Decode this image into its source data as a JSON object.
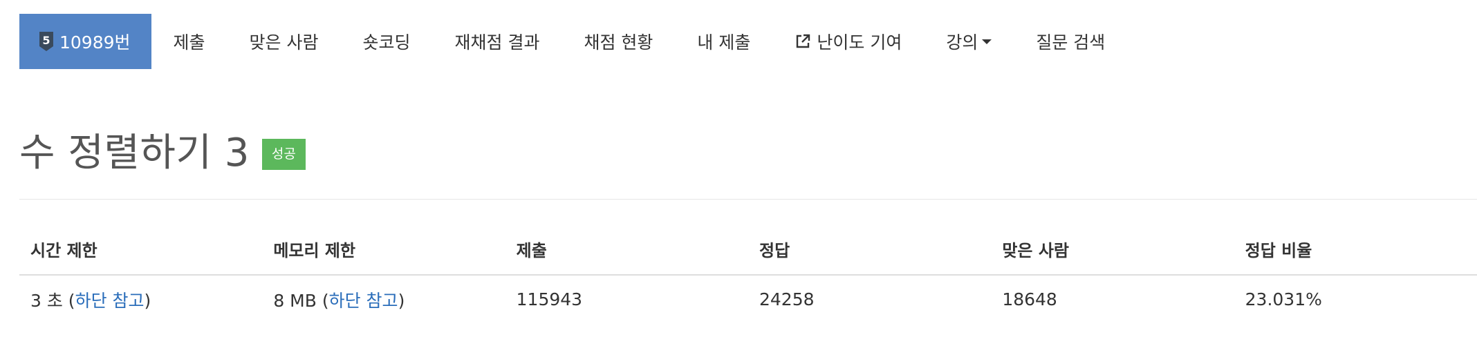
{
  "nav": {
    "problem_tier": "5",
    "problem_id": "10989번",
    "items": [
      "제출",
      "맞은 사람",
      "숏코딩",
      "재채점 결과",
      "채점 현황",
      "내 제출",
      "난이도 기여",
      "강의",
      "질문 검색"
    ],
    "active_color": "#5384c6"
  },
  "problem": {
    "title": "수 정렬하기 3",
    "status": "성공",
    "status_color": "#5cb85c"
  },
  "info_table": {
    "headers": [
      "시간 제한",
      "메모리 제한",
      "제출",
      "정답",
      "맞은 사람",
      "정답 비율"
    ],
    "time_limit": {
      "value": "3 초 (",
      "link": "하단 참고",
      "suffix": ")"
    },
    "memory_limit": {
      "value": "8 MB (",
      "link": "하단 참고",
      "suffix": ")"
    },
    "submissions": "115943",
    "accepted": "24258",
    "solved_users": "18648",
    "accuracy": "23.031%"
  }
}
